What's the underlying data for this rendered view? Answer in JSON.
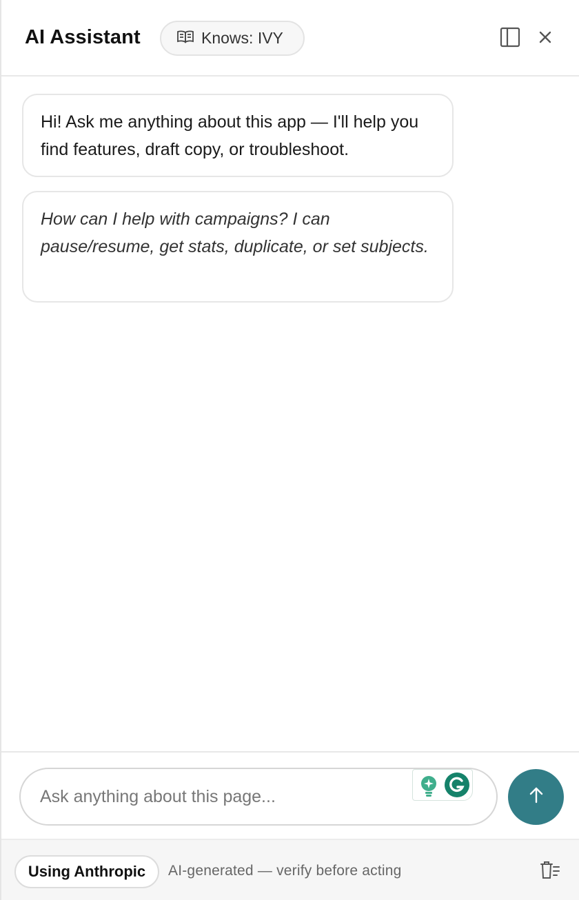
{
  "header": {
    "title": "AI Assistant",
    "knows_label": "Knows: IVY",
    "icons": {
      "knows": "book-open-icon",
      "sidebar": "sidebar-panel-icon",
      "close": "close-icon"
    }
  },
  "messages": [
    {
      "role": "assistant",
      "text": "Hi! Ask me anything about this app — I'll help you find features, draft copy, or troubleshoot."
    },
    {
      "role": "assistant",
      "text": "How can I help with campaigns? I can pause/resume, get stats, duplicate, or set subjects."
    }
  ],
  "composer": {
    "placeholder": "Ask anything about this page...",
    "value": "",
    "send_icon": "arrow-up-icon",
    "extension_icons": [
      "lightbulb-sparkle-icon",
      "grammarly-icon"
    ]
  },
  "footer": {
    "provider_label": "Using Anthropic",
    "disclaimer": "AI-generated — verify before acting",
    "clear_icon": "trash-list-icon"
  },
  "colors": {
    "accent": "#327d87",
    "grammarly": "#15826a",
    "bulb": "#3fae8c",
    "border": "#e6e6e6",
    "footer_bg": "#f6f6f6"
  }
}
